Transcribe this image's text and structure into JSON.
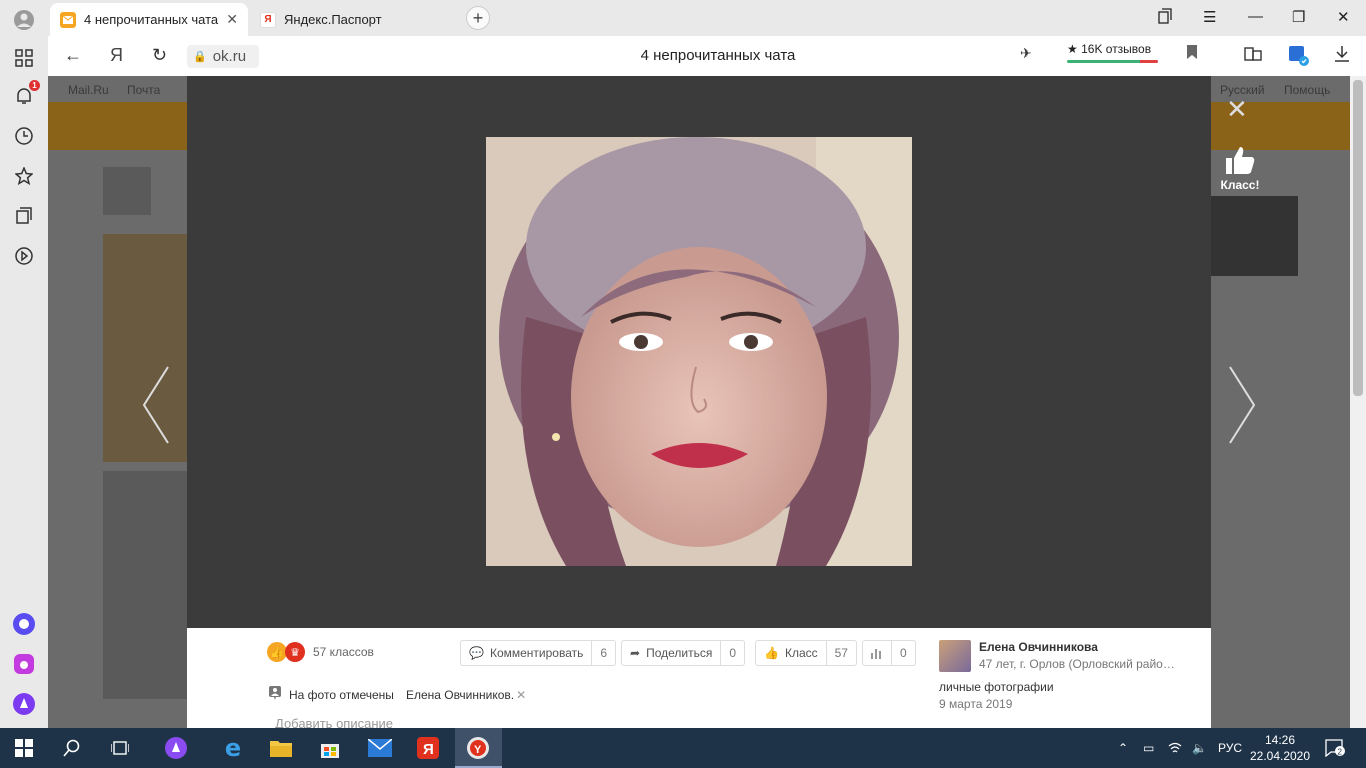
{
  "browser": {
    "tabs": [
      {
        "title": "4 непрочитанных чата",
        "favicon_color": "#f5a623",
        "active": true
      },
      {
        "title": "Яндекс.Паспорт",
        "favicon_color": "#e0301e",
        "favicon_letter": "Я",
        "active": false
      }
    ],
    "url": "ok.ru",
    "page_title": "4 непрочитанных чата",
    "reviews_label": "★ 16K отзывов",
    "notification_badge": "1"
  },
  "background_page": {
    "topnav": [
      "Mail.Ru",
      "Почта",
      "Русский",
      "Помощь"
    ]
  },
  "viewer": {
    "class_side_label": "Класс!",
    "reactions_count": "57 классов",
    "actions": {
      "comment": {
        "label": "Комментировать",
        "count": "6"
      },
      "share": {
        "label": "Поделиться",
        "count": "0"
      },
      "klass": {
        "label": "Класс",
        "count": "57"
      },
      "stats": {
        "count": "0"
      }
    },
    "tagged_label": "На фото отмечены",
    "tagged_person": "Елена Овчинников.",
    "add_description": "Добавить описание",
    "author": {
      "name": "Елена Овчинникова",
      "meta": "47 лет, г. Орлов (Орловский райо…"
    },
    "album": "личные фотографии",
    "date": "9 марта 2019"
  },
  "taskbar": {
    "lang": "РУС",
    "time": "14:26",
    "date": "22.04.2020",
    "notifications": "2"
  }
}
